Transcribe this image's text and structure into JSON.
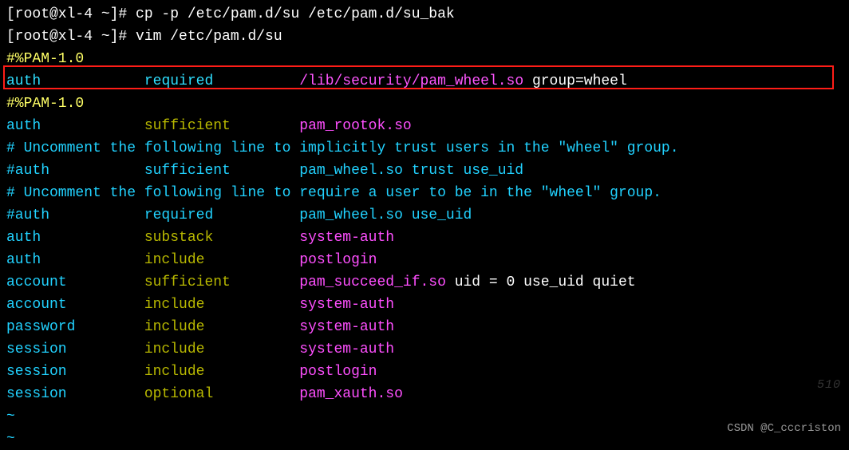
{
  "prompt": {
    "p1_prefix": "[root@xl-4 ~]# ",
    "cmd1": "cp -p /etc/pam.d/su /etc/pam.d/su_bak",
    "p2_prefix": "[root@xl-4 ~]# ",
    "cmd2": "vim /etc/pam.d/su"
  },
  "pam_header_1": "#%PAM-1.0",
  "highlight_line": {
    "col1": "auth",
    "col2": "required",
    "col3": "/lib/security/pam_wheel.so",
    "col4": " group=wheel"
  },
  "pam_header_2": "#%PAM-1.0",
  "lines": [
    {
      "col1": "auth",
      "col2": "sufficient",
      "col3": "pam_rootok.so",
      "col4": ""
    },
    {
      "comment": "# Uncomment the following line to implicitly trust users in the \"wheel\" group."
    },
    {
      "col1": "#auth",
      "col2": "sufficient",
      "col3": "pam_wheel.so trust use_uid",
      "col4": "",
      "commented": true
    },
    {
      "comment": "# Uncomment the following line to require a user to be in the \"wheel\" group."
    },
    {
      "col1": "#auth",
      "col2": "required",
      "col3": "pam_wheel.so use_uid",
      "col4": "",
      "commented": true
    },
    {
      "col1": "auth",
      "col2": "substack",
      "col3": "system-auth",
      "col4": ""
    },
    {
      "col1": "auth",
      "col2": "include",
      "col3": "postlogin",
      "col4": ""
    },
    {
      "col1": "account",
      "col2": "sufficient",
      "col3": "pam_succeed_if.so",
      "col4": " uid = 0 use_uid quiet"
    },
    {
      "col1": "account",
      "col2": "include",
      "col3": "system-auth",
      "col4": ""
    },
    {
      "col1": "password",
      "col2": "include",
      "col3": "system-auth",
      "col4": ""
    },
    {
      "col1": "session",
      "col2": "include",
      "col3": "system-auth",
      "col4": ""
    },
    {
      "col1": "session",
      "col2": "include",
      "col3": "postlogin",
      "col4": ""
    },
    {
      "col1": "session",
      "col2": "optional",
      "col3": "pam_xauth.so",
      "col4": ""
    }
  ],
  "tilde": "~",
  "watermark": "510",
  "credit": "CSDN @C_cccriston"
}
